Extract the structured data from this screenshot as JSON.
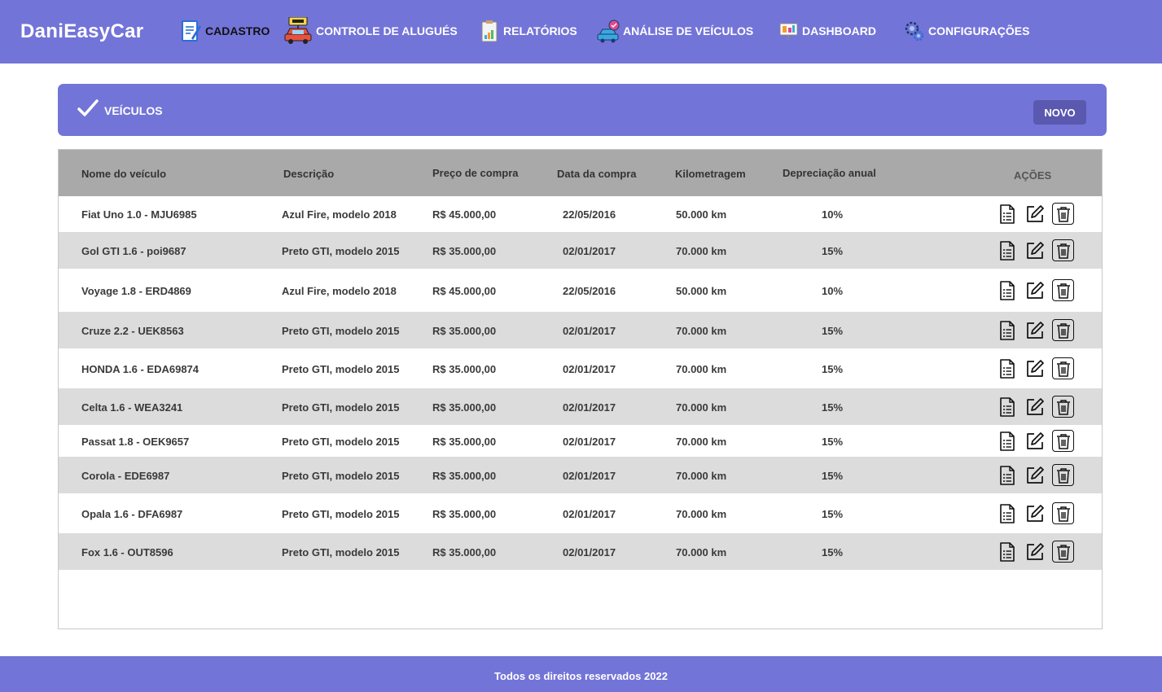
{
  "app": {
    "brand": "DaniEasyCar"
  },
  "nav": [
    {
      "label": "CADASTRO",
      "icon": "register-form-icon"
    },
    {
      "label": "CONTROLE DE ALUGUÉS",
      "icon": "rent-car-icon"
    },
    {
      "label": "RELATÓRIOS",
      "icon": "report-clipboard-icon"
    },
    {
      "label": "ANÁLISE DE VEÍCULOS",
      "icon": "vehicle-analysis-icon"
    },
    {
      "label": "DASHBOARD",
      "icon": "dashboard-board-icon"
    },
    {
      "label": "CONFIGURAÇÕES",
      "icon": "settings-gears-icon"
    }
  ],
  "section": {
    "title": "VEÍCULOS",
    "new_button": "NOVO"
  },
  "table": {
    "headers": [
      "Nome do veículo",
      "Descrição",
      "Preço de compra",
      "Data da compra",
      "Kilometragem",
      "Depreciação anual",
      "AÇÕES"
    ],
    "rows": [
      [
        "Fiat Uno 1.0 - MJU6985",
        "Azul Fire, modelo 2018",
        "R$ 45.000,00",
        "22/05/2016",
        "50.000 km",
        "10%"
      ],
      [
        "Gol GTI 1.6 - poi9687",
        "Preto GTI, modelo 2015",
        "R$ 35.000,00",
        "02/01/2017",
        "70.000 km",
        "15%"
      ],
      [
        "Voyage 1.8 - ERD4869",
        "Azul Fire, modelo 2018",
        "R$ 45.000,00",
        "22/05/2016",
        "50.000 km",
        "10%"
      ],
      [
        "Cruze 2.2 -  UEK8563",
        "Preto GTI, modelo 2015",
        "R$ 35.000,00",
        "02/01/2017",
        "70.000 km",
        "15%"
      ],
      [
        "HONDA 1.6 - EDA69874",
        "Preto GTI, modelo 2015",
        "R$ 35.000,00",
        "02/01/2017",
        "70.000 km",
        "15%"
      ],
      [
        "Celta 1.6 - WEA3241",
        "Preto GTI, modelo 2015",
        "R$ 35.000,00",
        "02/01/2017",
        "70.000 km",
        "15%"
      ],
      [
        "Passat 1.8 - OEK9657",
        "Preto GTI, modelo 2015",
        "R$ 35.000,00",
        "02/01/2017",
        "70.000 km",
        "15%"
      ],
      [
        "Corola - EDE6987",
        "Preto GTI, modelo 2015",
        "R$ 35.000,00",
        "02/01/2017",
        "70.000 km",
        "15%"
      ],
      [
        "Opala 1.6 - DFA6987",
        "Preto GTI, modelo 2015",
        "R$ 35.000,00",
        "02/01/2017",
        "70.000 km",
        "15%"
      ],
      [
        "Fox 1.6 - OUT8596",
        "Preto GTI, modelo 2015",
        "R$ 35.000,00",
        "02/01/2017",
        "70.000 km",
        "15%"
      ]
    ],
    "row_actions": [
      "details-document-icon",
      "edit-pencil-icon",
      "delete-trash-icon"
    ]
  },
  "footer": {
    "text": "Todos os direitos reservados 2022"
  },
  "colors": {
    "primary": "#7374d8",
    "button": "#5b58b0",
    "header_row": "#a9a9a9",
    "alt_row": "#dcdcdc"
  }
}
